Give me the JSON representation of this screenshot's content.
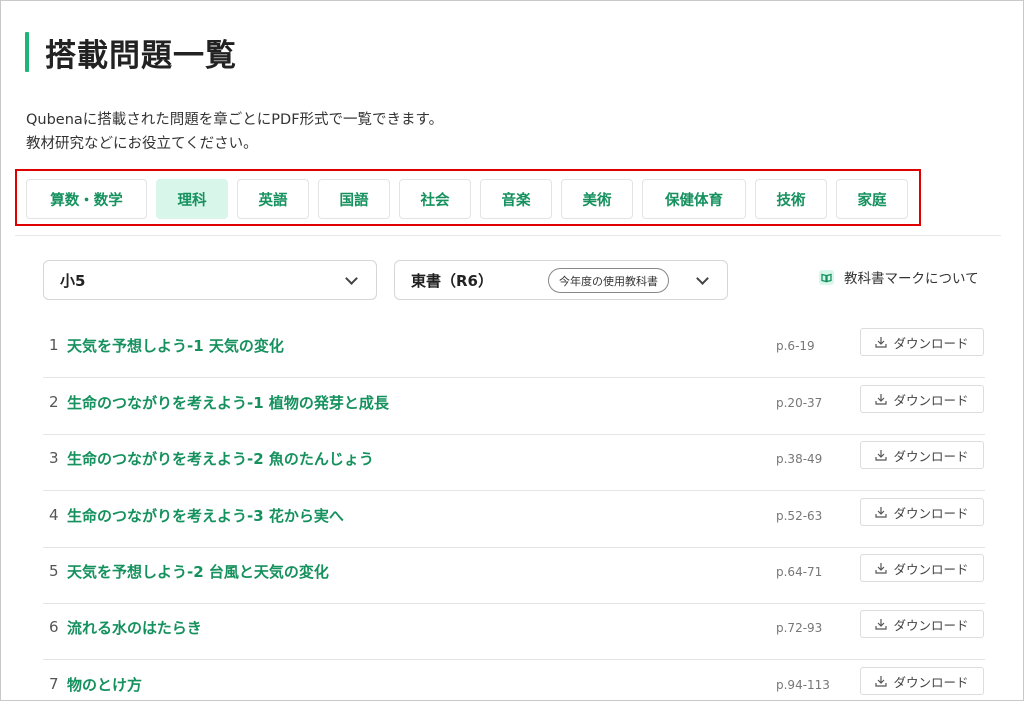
{
  "page": {
    "title": "搭載問題一覧",
    "description_line1": "Qubenaに搭載された問題を章ごとにPDF形式で一覧できます。",
    "description_line2": "教材研究などにお役立てください。"
  },
  "subjects": [
    {
      "label": "算数・数学",
      "active": false
    },
    {
      "label": "理科",
      "active": true
    },
    {
      "label": "英語",
      "active": false
    },
    {
      "label": "国語",
      "active": false
    },
    {
      "label": "社会",
      "active": false
    },
    {
      "label": "音楽",
      "active": false
    },
    {
      "label": "美術",
      "active": false
    },
    {
      "label": "保健体育",
      "active": false
    },
    {
      "label": "技術",
      "active": false
    },
    {
      "label": "家庭",
      "active": false
    }
  ],
  "filters": {
    "grade": "小5",
    "textbook": "東書（R6）",
    "textbook_badge": "今年度の使用教科書",
    "mark_link": "教科書マークについて"
  },
  "chapters": [
    {
      "num": "1",
      "name": "天気を予想しよう-1 天気の変化",
      "pages": "p.6-19",
      "download": "ダウンロード"
    },
    {
      "num": "2",
      "name": "生命のつながりを考えよう-1 植物の発芽と成長",
      "pages": "p.20-37",
      "download": "ダウンロード"
    },
    {
      "num": "3",
      "name": "生命のつながりを考えよう-2 魚のたんじょう",
      "pages": "p.38-49",
      "download": "ダウンロード"
    },
    {
      "num": "4",
      "name": "生命のつながりを考えよう-3 花から実へ",
      "pages": "p.52-63",
      "download": "ダウンロード"
    },
    {
      "num": "5",
      "name": "天気を予想しよう-2 台風と天気の変化",
      "pages": "p.64-71",
      "download": "ダウンロード"
    },
    {
      "num": "6",
      "name": "流れる水のはたらき",
      "pages": "p.72-93",
      "download": "ダウンロード"
    },
    {
      "num": "7",
      "name": "物のとけ方",
      "pages": "p.94-113",
      "download": "ダウンロード"
    }
  ],
  "colors": {
    "accent": "#15915e",
    "active_tab_bg": "#d9f6ea",
    "highlight_outline": "#e00000"
  },
  "icons": {
    "download": "download-icon",
    "book": "book-icon",
    "chevron": "chevron-down-icon"
  }
}
